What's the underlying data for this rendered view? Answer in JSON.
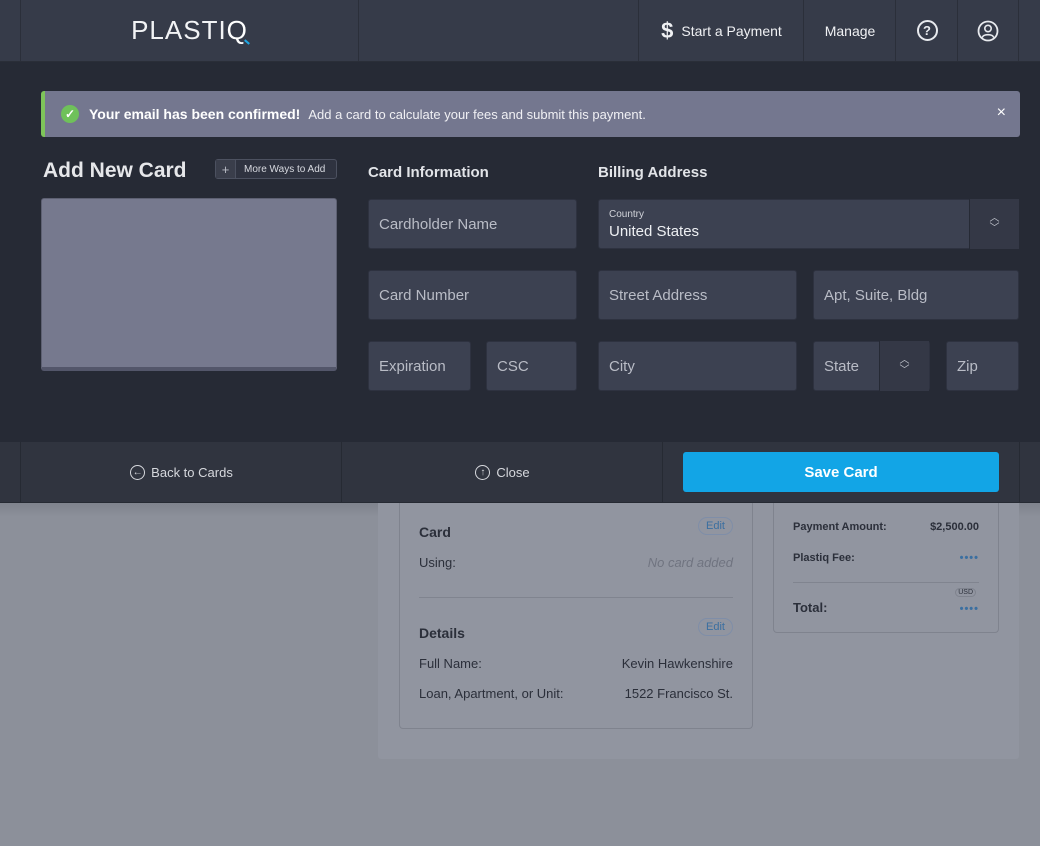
{
  "nav": {
    "logo_text": "PLASTI",
    "logo_q": "Q",
    "start_payment_icon": "$",
    "start_payment": "Start a Payment",
    "manage": "Manage",
    "help_icon": "?",
    "user_icon": "person-icon"
  },
  "alert": {
    "strong": "Your email has been confirmed!",
    "text": "Add a card to calculate your fees and submit this payment.",
    "close": "×",
    "status_color": "#7ec55a"
  },
  "add_card": {
    "title": "Add New Card",
    "more_ways_icon": "+",
    "more_ways": "More Ways to Add"
  },
  "card_info": {
    "title": "Card Information",
    "cardholder_placeholder": "Cardholder Name",
    "number_placeholder": "Card Number",
    "expiration_placeholder": "Expiration",
    "csc_placeholder": "CSC"
  },
  "billing": {
    "title": "Billing Address",
    "country_label": "Country",
    "country_value": "United States",
    "street_placeholder": "Street Address",
    "apt_placeholder": "Apt, Suite, Bldg",
    "city_placeholder": "City",
    "state_placeholder": "State",
    "zip_placeholder": "Zip"
  },
  "footer": {
    "back_icon": "←",
    "back": "Back to Cards",
    "close_icon": "↑",
    "close": "Close",
    "save": "Save Card",
    "save_color": "#12a5e6"
  },
  "background": {
    "card_section": {
      "title": "Card",
      "edit": "Edit",
      "using_label": "Using:",
      "using_value": "No card added"
    },
    "details_section": {
      "title": "Details",
      "edit": "Edit",
      "full_name_label": "Full Name:",
      "full_name_value": "Kevin Hawkenshire",
      "loan_label": "Loan, Apartment, or Unit:",
      "loan_value": "1522 Francisco St."
    },
    "summary": {
      "payment_label": "Payment Amount:",
      "payment_value": "$2,500.00",
      "fee_label": "Plastiq Fee:",
      "fee_value": "••••",
      "currency": "USD",
      "total_label": "Total:",
      "total_value": "••••"
    }
  }
}
